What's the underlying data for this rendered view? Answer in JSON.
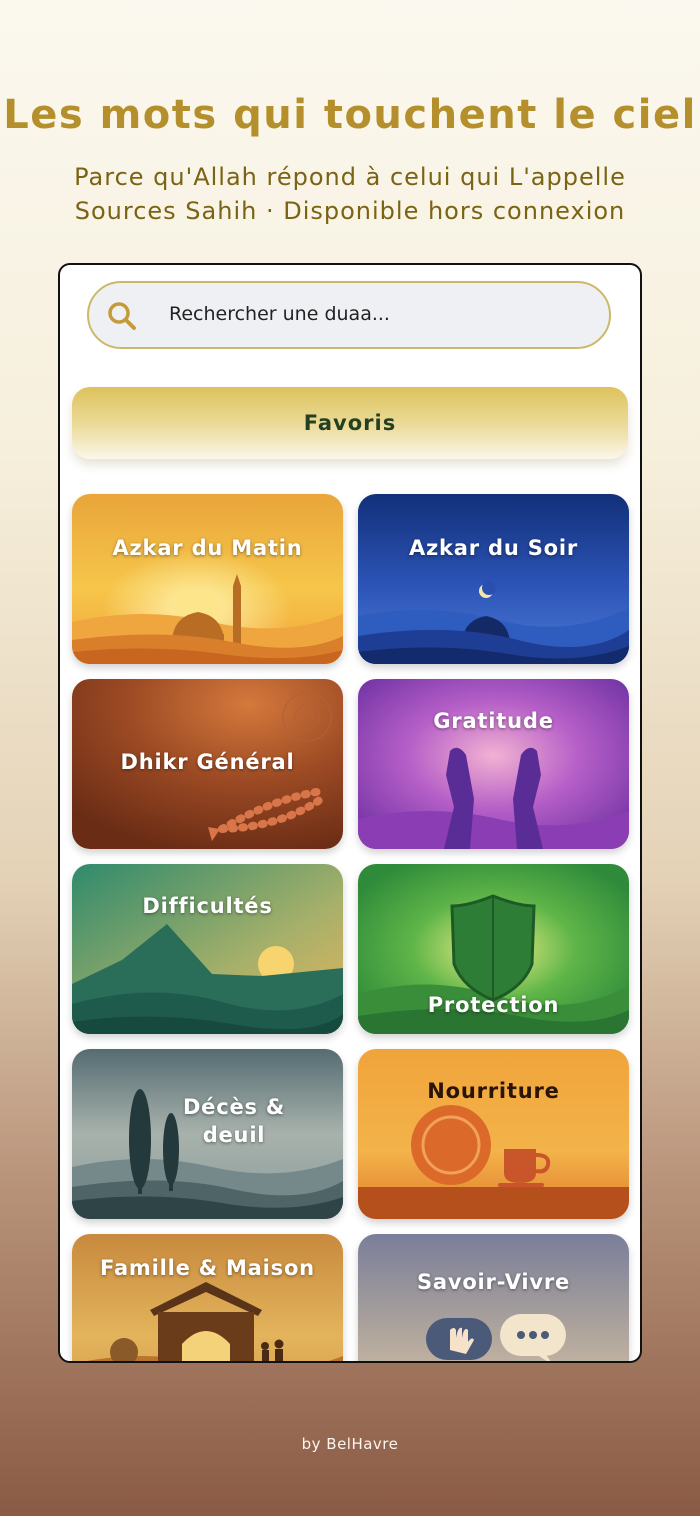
{
  "header": {
    "title": "Les mots qui touchent le ciel",
    "subtitle_1": "Parce qu'Allah répond à celui qui L'appelle",
    "subtitle_2": "Sources Sahih · Disponible hors connexion"
  },
  "search": {
    "placeholder": "Rechercher une duaa..."
  },
  "favorites": {
    "label": "Favoris"
  },
  "categories": [
    {
      "label": "Azkar du Matin"
    },
    {
      "label": "Azkar du Soir"
    },
    {
      "label": "Dhikr Général"
    },
    {
      "label": "Gratitude"
    },
    {
      "label": "Difficultés"
    },
    {
      "label": "Protection"
    },
    {
      "label": "Décès &\ndeuil"
    },
    {
      "label": "Nourriture"
    },
    {
      "label": "Famille & Maison"
    },
    {
      "label": "Savoir-Vivre"
    }
  ],
  "footer": {
    "credit": "by BelHavre"
  },
  "colors": {
    "title_gold": "#b48f2c",
    "subtitle_olive": "#7a6414",
    "favorites_text": "#24401f"
  }
}
